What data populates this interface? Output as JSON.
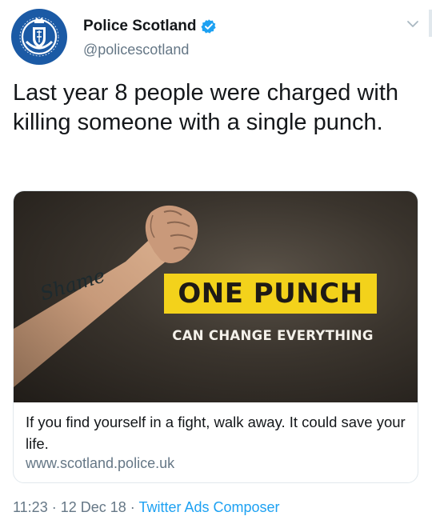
{
  "author": {
    "name": "Police Scotland",
    "handle": "@policescotland"
  },
  "tweet": {
    "text": "Last year 8 people were charged with killing someone with a single punch."
  },
  "card": {
    "image": {
      "headline": "ONE PUNCH",
      "subline": "CAN CHANGE EVERYTHING",
      "tattoo_text": "Shame"
    },
    "description": "If you find yourself in a fight, walk away. It could save your life.",
    "url": "www.scotland.police.uk"
  },
  "meta": {
    "time": "11:23",
    "separator1": " · ",
    "date": "12 Dec 18",
    "separator2": " · ",
    "source": "Twitter Ads Composer"
  },
  "colors": {
    "accent": "#1da1f2",
    "badge": "#f3d21b",
    "avatar": "#1b5aa5",
    "secondary_text": "#657786"
  },
  "icons": {
    "avatar": "police-crest-icon",
    "verified": "verified-badge-icon",
    "caret": "chevron-down-icon"
  }
}
